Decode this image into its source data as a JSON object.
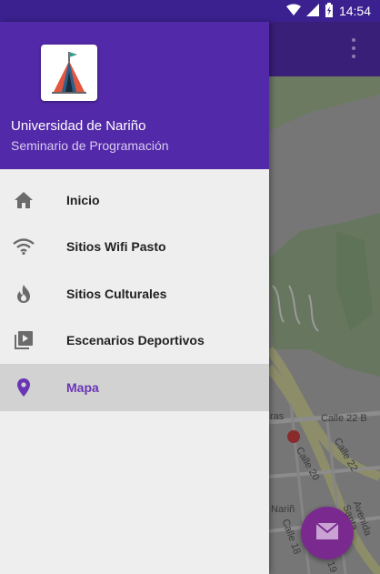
{
  "status_bar": {
    "time": "14:54",
    "icons": [
      "wifi-icon",
      "signal-icon",
      "battery-icon"
    ]
  },
  "drawer": {
    "header": {
      "title": "Universidad de Nariño",
      "subtitle": "Seminario de Programación",
      "logo": "tent-logo"
    },
    "items": [
      {
        "label": "Inicio",
        "icon": "home-icon",
        "selected": false
      },
      {
        "label": "Sitios Wifi Pasto",
        "icon": "wifi-icon",
        "selected": false
      },
      {
        "label": "Sitios Culturales",
        "icon": "fire-icon",
        "selected": false
      },
      {
        "label": "Escenarios Deportivos",
        "icon": "video-library-icon",
        "selected": false
      },
      {
        "label": "Mapa",
        "icon": "location-pin-icon",
        "selected": true
      }
    ]
  },
  "app_bar": {
    "overflow_icon": "more-vert-icon"
  },
  "map": {
    "labels": [
      "Calle 22 B",
      "Calle 22",
      "Calle 20",
      "Avenida Santa",
      "Calle 18",
      "Calle 19",
      "Nariñ",
      "ras"
    ]
  },
  "fab": {
    "icon": "mail-icon"
  },
  "colors": {
    "header": "#5229a8",
    "status_bar": "#3b2190",
    "accent": "#6a35b5",
    "fab": "#7a2a8f"
  }
}
